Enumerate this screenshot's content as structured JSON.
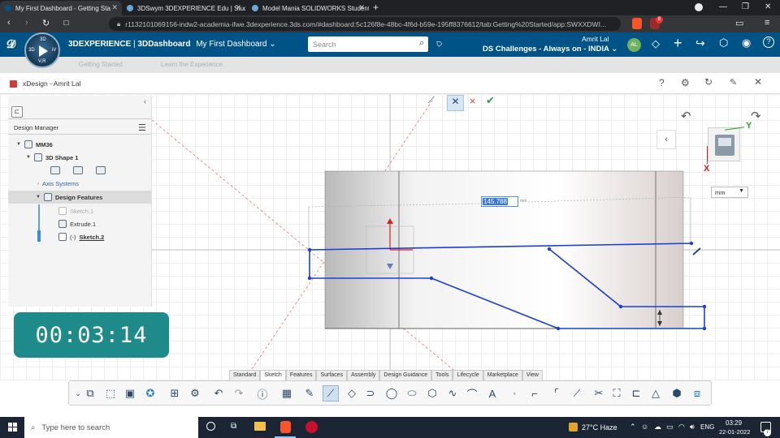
{
  "browser": {
    "tabs": [
      {
        "title": "My First Dashboard - Getting Sta",
        "active": true
      },
      {
        "title": "3DSwym 3DEXPERIENCE Edu | Studen",
        "active": false
      },
      {
        "title": "Model Mania SOLIDWORKS Student C",
        "active": false
      }
    ],
    "new_tab": "+",
    "url": "r1132101069156-indw2-academia-ifwe.3dexperience.3ds.com/#dashboard:5c126f8e-48bc-4f6d-b59e-195ff8376612/tab:Getting%20Started/app:SWXXDWI...",
    "brave_badge": "8"
  },
  "platform": {
    "brand": "3DEXPERIENCE",
    "app": "3DDashboard",
    "dashboard": "My First Dashboard",
    "search_placeholder": "Search",
    "user": "Amrit Lal",
    "role": "DS Challenges - Always on - INDIA",
    "avatar": "AL",
    "compass_labels": {
      "top": "3D",
      "left": "3D",
      "right": "iV",
      "bottom": "V,R"
    }
  },
  "subheader": {
    "items": [
      "Getting Started",
      "Learn the Experience"
    ]
  },
  "app": {
    "title": "xDesign - Amrit Lal",
    "help": "?"
  },
  "design_manager": {
    "title": "Design Manager",
    "tree": [
      {
        "label": "MM36"
      },
      {
        "label": "3D Shape 1"
      },
      {
        "label": "Axis Systems"
      },
      {
        "label": "Design Features"
      },
      {
        "label": "Sketch.1"
      },
      {
        "label": "Extrude.1"
      },
      {
        "label": "Sketch.2",
        "prefix": "(-)"
      }
    ]
  },
  "sketch": {
    "dimension_value": "145.788",
    "dimension_unit": "mm",
    "unit_selector": "mm"
  },
  "compass_axes": {
    "y": "Y",
    "x": "X"
  },
  "timer": "00:03:14",
  "toolbar": {
    "tabs": [
      "Standard",
      "Sketch",
      "Features",
      "Surfaces",
      "Assembly",
      "Design Guidance",
      "Tools",
      "Lifecycle",
      "Marketplace",
      "View"
    ],
    "active_tab": "Sketch"
  },
  "taskbar": {
    "search_placeholder": "Type here to search",
    "weather": "27°C Haze",
    "language": "ENG",
    "time": "03:29",
    "date": "22-01-2022",
    "notifications": "7"
  },
  "colors": {
    "header": "#005386",
    "sketch": "#1c3fd1",
    "timer": "#1f8a8a",
    "taskbar": "#1c2533"
  }
}
